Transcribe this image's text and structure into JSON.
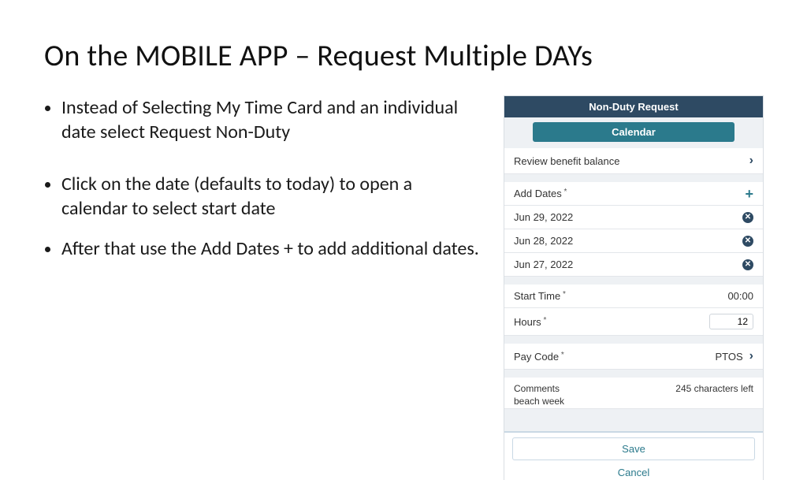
{
  "title": "On the MOBILE APP – Request Multiple DAYs",
  "bullets": [
    "Instead of Selecting My Time Card and an individual date select Request Non-Duty",
    "Click on the date (defaults to today) to open a calendar to select start date",
    "After that use the Add Dates + to add additional dates."
  ],
  "phone": {
    "header": "Non-Duty Request",
    "calendar_btn": "Calendar",
    "review_row": "Review benefit balance",
    "add_dates_label": "Add Dates",
    "dates": [
      "Jun 29, 2022",
      "Jun 28, 2022",
      "Jun 27, 2022"
    ],
    "start_time_label": "Start Time",
    "start_time_value": "00:00",
    "hours_label": "Hours",
    "hours_value": "12",
    "paycode_label": "Pay Code",
    "paycode_value": "PTOS",
    "comments_label": "Comments",
    "comments_remaining": "245 characters left",
    "comments_value": "beach week",
    "save": "Save",
    "cancel": "Cancel"
  }
}
